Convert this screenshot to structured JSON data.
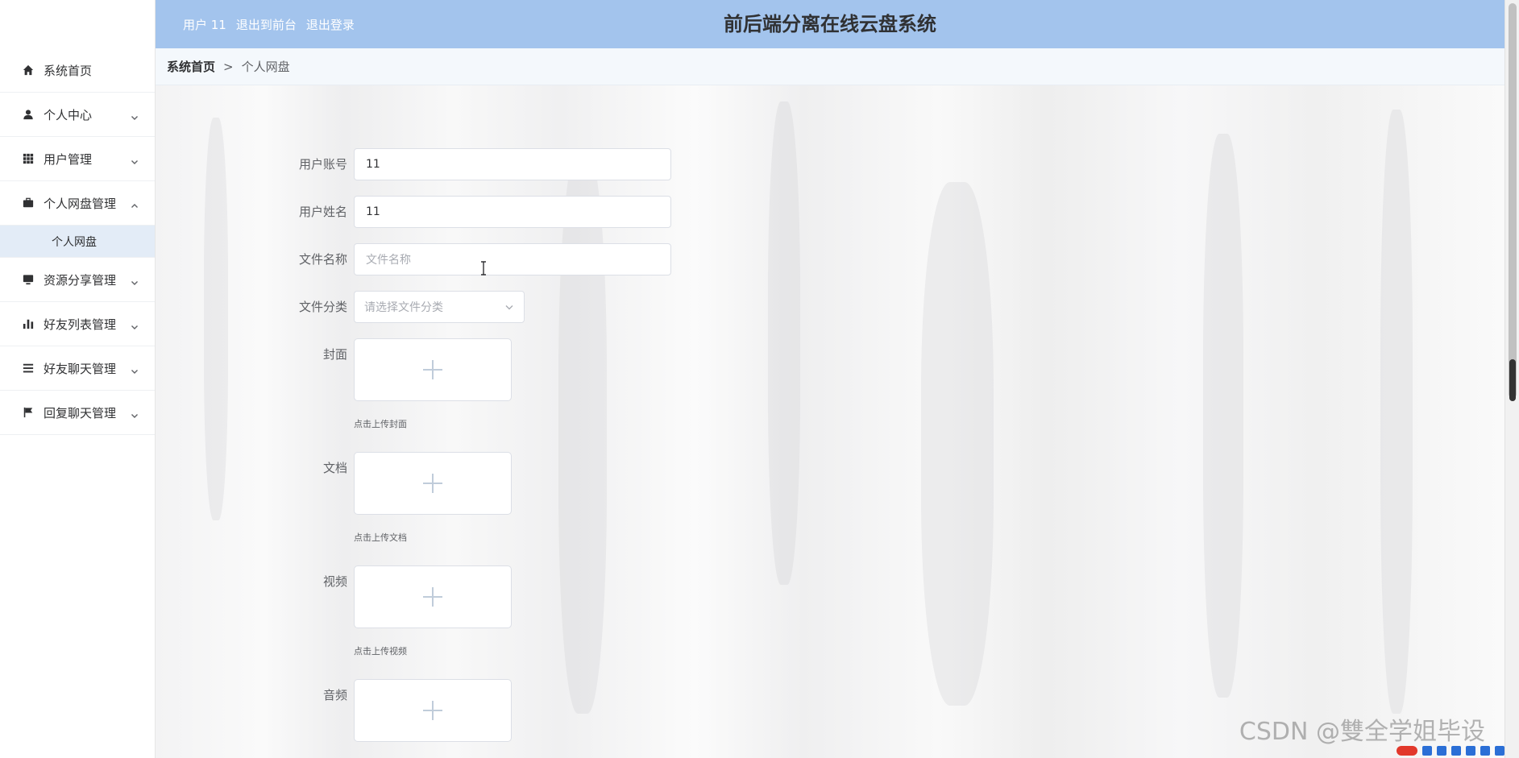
{
  "app": {
    "title": "前后端分离在线云盘系统"
  },
  "header": {
    "user_label": "用户 11",
    "frontend_link": "退出到前台",
    "logout_link": "退出登录"
  },
  "sidebar": {
    "items": [
      {
        "label": "系统首页",
        "icon": "home-icon",
        "has_children": false
      },
      {
        "label": "个人中心",
        "icon": "user-icon",
        "has_children": true
      },
      {
        "label": "用户管理",
        "icon": "grid-icon",
        "has_children": true
      },
      {
        "label": "个人网盘管理",
        "icon": "briefcase-icon",
        "has_children": true,
        "expanded": true,
        "children": [
          {
            "label": "个人网盘",
            "active": true
          }
        ]
      },
      {
        "label": "资源分享管理",
        "icon": "monitor-icon",
        "has_children": true
      },
      {
        "label": "好友列表管理",
        "icon": "bar-chart-icon",
        "has_children": true
      },
      {
        "label": "好友聊天管理",
        "icon": "list-icon",
        "has_children": true
      },
      {
        "label": "回复聊天管理",
        "icon": "flag-icon",
        "has_children": true
      }
    ]
  },
  "breadcrumb": {
    "home": "系统首页",
    "separator": ">",
    "current": "个人网盘"
  },
  "form": {
    "account": {
      "label": "用户账号",
      "value": "11"
    },
    "name": {
      "label": "用户姓名",
      "value": "11"
    },
    "filename": {
      "label": "文件名称",
      "placeholder": "文件名称"
    },
    "category": {
      "label": "文件分类",
      "placeholder": "请选择文件分类"
    },
    "cover": {
      "label": "封面",
      "tip": "点击上传封面"
    },
    "document": {
      "label": "文档",
      "tip": "点击上传文档"
    },
    "video": {
      "label": "视频",
      "tip": "点击上传视频"
    },
    "audio": {
      "label": "音频"
    }
  },
  "watermark": "CSDN @雙全学姐毕设",
  "colors": {
    "header_bg": "#a3c4ed",
    "active_menu_bg": "#e3ecf7",
    "breadcrumb_bg": "#f4f8fc"
  }
}
